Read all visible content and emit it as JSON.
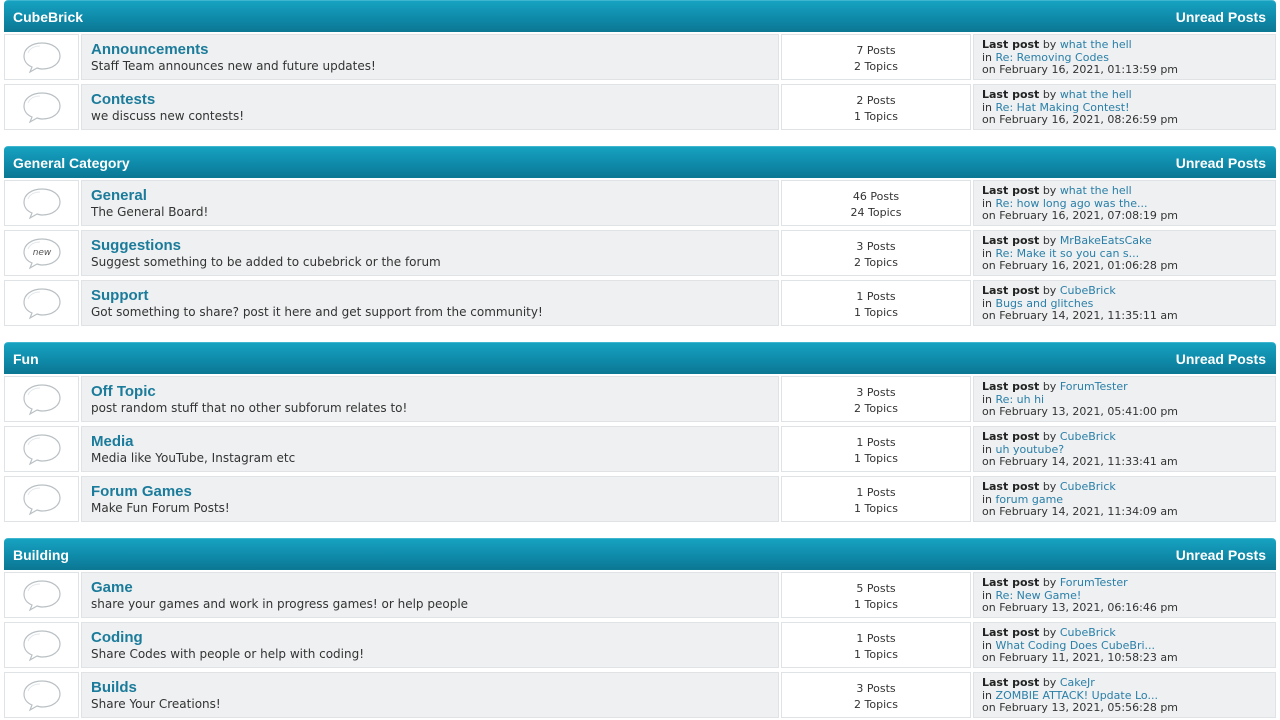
{
  "common": {
    "unread_label": "Unread Posts",
    "last_post_label": "Last post",
    "by": "by",
    "in": "in",
    "on": "on"
  },
  "categories": [
    {
      "name": "CubeBrick",
      "boards": [
        {
          "name": "Announcements",
          "desc": "Staff Team announces new and future updates!",
          "posts": "7 Posts",
          "topics": "2 Topics",
          "user": "what the hell",
          "topic": "Re: Removing Codes",
          "date": "February 16, 2021, 01:13:59 pm",
          "icon": "bubble-icon"
        },
        {
          "name": "Contests",
          "desc": "we discuss new contests!",
          "posts": "2 Posts",
          "topics": "1 Topics",
          "user": "what the hell",
          "topic": "Re: Hat Making Contest!",
          "date": "February 16, 2021, 08:26:59 pm",
          "icon": "bubble-icon"
        }
      ]
    },
    {
      "name": "General Category",
      "boards": [
        {
          "name": "General",
          "desc": "The General Board!",
          "posts": "46 Posts",
          "topics": "24 Topics",
          "user": "what the hell",
          "topic": "Re: how long ago was the...",
          "date": "February 16, 2021, 07:08:19 pm",
          "icon": "bubble-icon"
        },
        {
          "name": "Suggestions",
          "desc": "Suggest something to be added to cubebrick or the forum",
          "posts": "3 Posts",
          "topics": "2 Topics",
          "user": "MrBakeEatsCake",
          "topic": "Re: Make it so you can s...",
          "date": "February 16, 2021, 01:06:28 pm",
          "icon": "bubble-new-icon",
          "icon_text": "new"
        },
        {
          "name": "Support",
          "desc": "Got something to share? post it here and get support from the community!",
          "posts": "1 Posts",
          "topics": "1 Topics",
          "user": "CubeBrick",
          "topic": "Bugs and glitches",
          "date": "February 14, 2021, 11:35:11 am",
          "icon": "bubble-icon"
        }
      ]
    },
    {
      "name": "Fun",
      "boards": [
        {
          "name": "Off Topic",
          "desc": "post random stuff that no other subforum relates to!",
          "posts": "3 Posts",
          "topics": "2 Topics",
          "user": "ForumTester",
          "topic": "Re: uh hi",
          "date": "February 13, 2021, 05:41:00 pm",
          "icon": "bubble-icon"
        },
        {
          "name": "Media",
          "desc": "Media like YouTube, Instagram etc",
          "posts": "1 Posts",
          "topics": "1 Topics",
          "user": "CubeBrick",
          "topic": "uh youtube?",
          "date": "February 14, 2021, 11:33:41 am",
          "icon": "bubble-icon"
        },
        {
          "name": "Forum Games",
          "desc": "Make Fun Forum Posts!",
          "posts": "1 Posts",
          "topics": "1 Topics",
          "user": "CubeBrick",
          "topic": "forum game",
          "date": "February 14, 2021, 11:34:09 am",
          "icon": "bubble-icon"
        }
      ]
    },
    {
      "name": "Building",
      "boards": [
        {
          "name": "Game",
          "desc": "share your games and work in progress games! or help people",
          "posts": "5 Posts",
          "topics": "1 Topics",
          "user": "ForumTester",
          "topic": "Re: New Game!",
          "date": "February 13, 2021, 06:16:46 pm",
          "icon": "bubble-icon"
        },
        {
          "name": "Coding",
          "desc": "Share Codes with people or help with coding!",
          "posts": "1 Posts",
          "topics": "1 Topics",
          "user": "CubeBrick",
          "topic": "What Coding Does CubeBri...",
          "date": "February 11, 2021, 10:58:23 am",
          "icon": "bubble-icon"
        },
        {
          "name": "Builds",
          "desc": "Share Your Creations!",
          "posts": "3 Posts",
          "topics": "2 Topics",
          "user": "CakeJr",
          "topic": "ZOMBIE ATTACK! Update Lo...",
          "date": "February 13, 2021, 05:56:28 pm",
          "icon": "bubble-icon"
        }
      ]
    }
  ]
}
